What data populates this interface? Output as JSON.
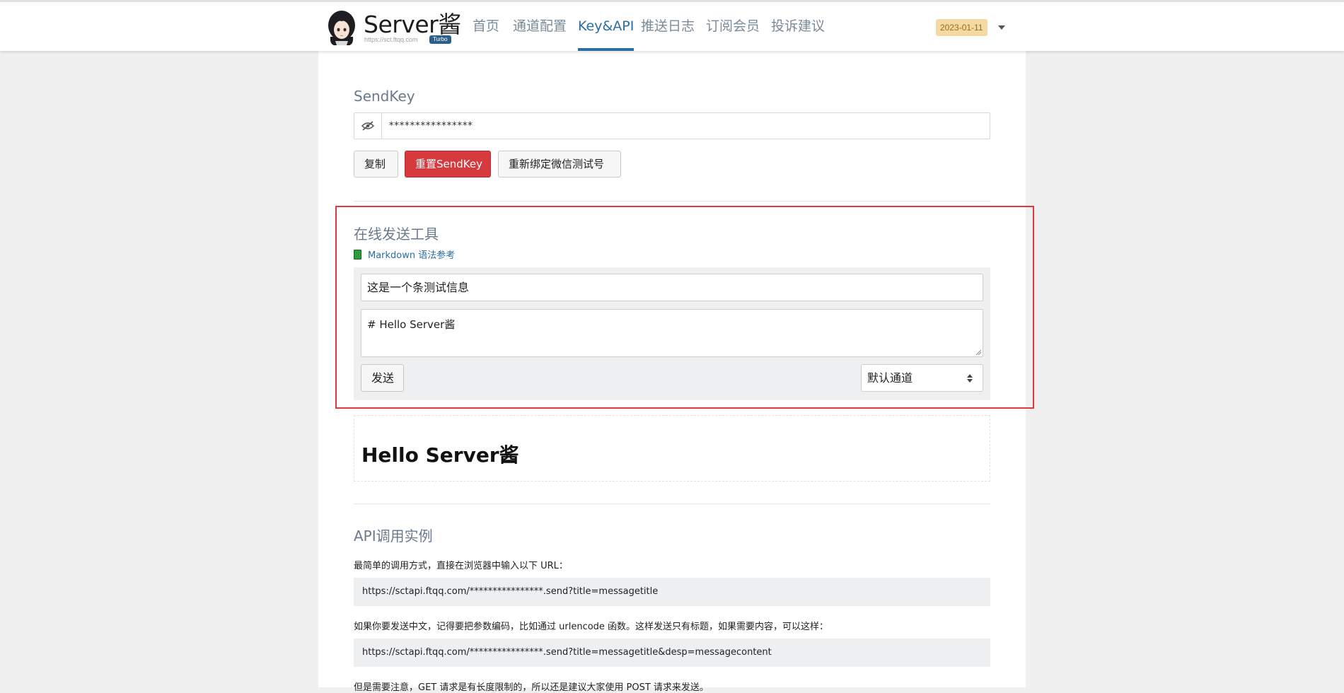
{
  "header": {
    "brand_title": "Server酱",
    "brand_url": "https://sct.ftqq.com",
    "brand_badge": "Turbo",
    "nav": [
      {
        "label": "首页",
        "active": false
      },
      {
        "label": "通道配置",
        "active": false
      },
      {
        "label": "Key&API",
        "active": true
      },
      {
        "label": "推送日志",
        "active": false
      },
      {
        "label": "订阅会员",
        "active": false
      },
      {
        "label": "投诉建议",
        "active": false
      }
    ],
    "date_badge": "2023-01-11"
  },
  "sendkey": {
    "heading": "SendKey",
    "value": "****************",
    "copy_label": "复制",
    "reset_label": "重置SendKey",
    "rebind_label": "重新绑定微信测试号"
  },
  "send_tool": {
    "heading": "在线发送工具",
    "markdown_link": "Markdown 语法参考",
    "title_value": "这是一个条测试信息",
    "content_value": "# Hello Server酱",
    "send_label": "发送",
    "channel_selected": "默认通道",
    "preview_heading": "Hello Server酱"
  },
  "api": {
    "heading": "API调用实例",
    "intro": "最简单的调用方式，直接在浏览器中输入以下 URL：",
    "url1": "https://sctapi.ftqq.com/****************.send?title=messagetitle",
    "note": "如果你要发送中文，记得要把参数编码，比如通过 urlencode 函数。这样发送只有标题，如果需要内容，可以这样：",
    "url2": "https://sctapi.ftqq.com/****************.send?title=messagetitle&desp=messagecontent",
    "footer_note": "但是需要注意，GET 请求是有长度限制的，所以还是建议大家使用 POST 请求来发送。"
  },
  "colors": {
    "accent": "#2a6ea3",
    "danger": "#d73a3e",
    "highlight": "#e03a3e"
  }
}
